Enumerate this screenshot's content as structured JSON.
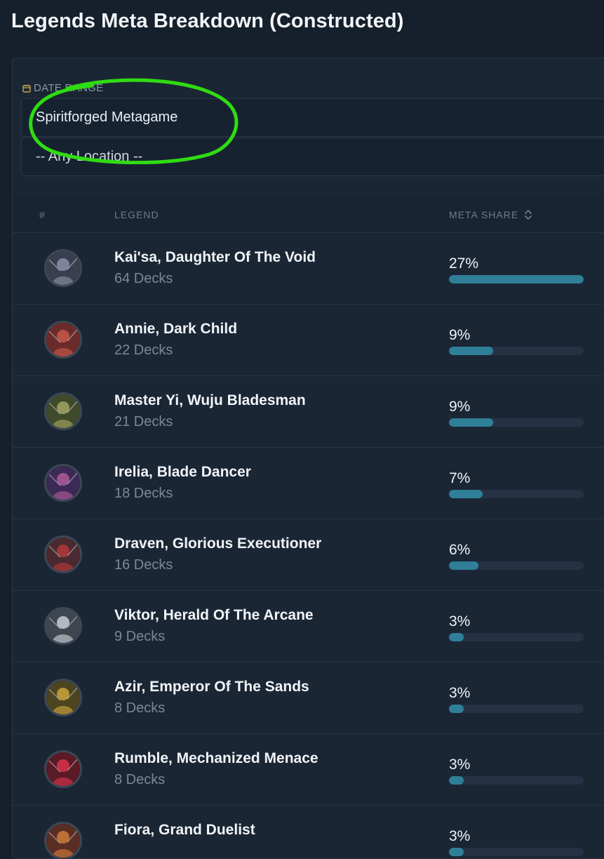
{
  "page": {
    "title": "Legends Meta Breakdown (Constructed)"
  },
  "filters": {
    "date_range_label": "DATE RANGE",
    "date_range_value": "Spiritforged Metagame",
    "location_value": "-- Any Location --"
  },
  "table": {
    "columns": {
      "rank": "#",
      "legend": "LEGEND",
      "meta_share": "META SHARE"
    },
    "rows": [
      {
        "name": "Kai'sa, Daughter Of The Void",
        "decks": "64 Decks",
        "share_label": "27%",
        "share_fraction": 1.0,
        "avatar_color": "#3a3f4f",
        "avatar_accent": "#8a8fa8"
      },
      {
        "name": "Annie, Dark Child",
        "decks": "22 Decks",
        "share_label": "9%",
        "share_fraction": 0.33,
        "avatar_color": "#6b2b2b",
        "avatar_accent": "#c8584a"
      },
      {
        "name": "Master Yi, Wuju Bladesman",
        "decks": "21 Decks",
        "share_label": "9%",
        "share_fraction": 0.33,
        "avatar_color": "#3e4a2a",
        "avatar_accent": "#a4a460"
      },
      {
        "name": "Irelia, Blade Dancer",
        "decks": "18 Decks",
        "share_label": "7%",
        "share_fraction": 0.25,
        "avatar_color": "#3b2a55",
        "avatar_accent": "#b05a9a"
      },
      {
        "name": "Draven, Glorious Executioner",
        "decks": "16 Decks",
        "share_label": "6%",
        "share_fraction": 0.22,
        "avatar_color": "#4a2a30",
        "avatar_accent": "#b23a3a"
      },
      {
        "name": "Viktor, Herald Of The Arcane",
        "decks": "9 Decks",
        "share_label": "3%",
        "share_fraction": 0.11,
        "avatar_color": "#3f4650",
        "avatar_accent": "#c9cdd2"
      },
      {
        "name": "Azir, Emperor Of The Sands",
        "decks": "8 Decks",
        "share_label": "3%",
        "share_fraction": 0.11,
        "avatar_color": "#4d4420",
        "avatar_accent": "#c9a53a"
      },
      {
        "name": "Rumble, Mechanized Menace",
        "decks": "8 Decks",
        "share_label": "3%",
        "share_fraction": 0.11,
        "avatar_color": "#5a1a26",
        "avatar_accent": "#d8324a"
      },
      {
        "name": "Fiora, Grand Duelist",
        "decks": "",
        "share_label": "3%",
        "share_fraction": 0.11,
        "avatar_color": "#5a2e22",
        "avatar_accent": "#d07a3a"
      }
    ]
  },
  "colors": {
    "annotation_circle": "#2fdc12",
    "bar_fill": "#2f7f99",
    "bar_track": "#243244"
  }
}
